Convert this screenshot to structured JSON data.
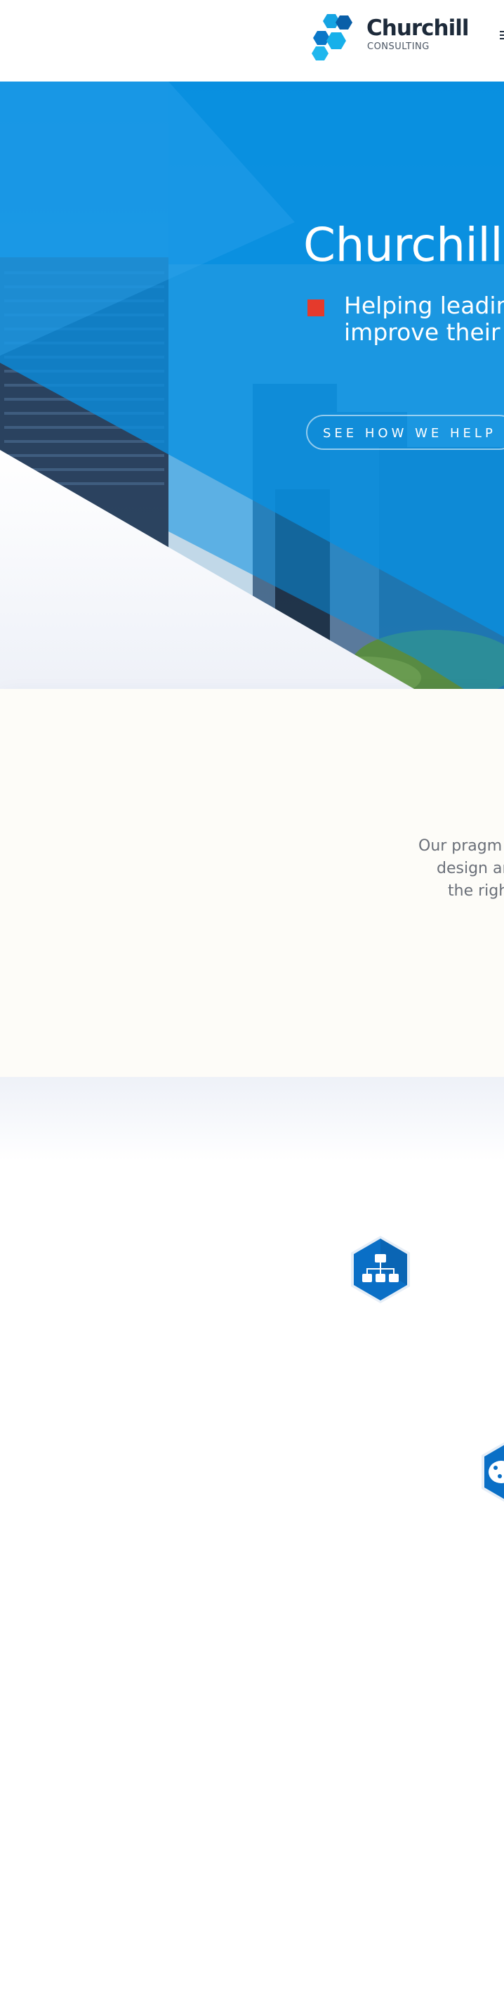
{
  "header": {
    "brand_name": "Churchill",
    "brand_sub": "CONSULTING",
    "menu_icon": "hamburger-icon"
  },
  "hero": {
    "title": "Churchill",
    "tagline_lines": [
      "Helping leadin",
      "improve their"
    ],
    "cta_label": "SEE HOW WE HELP",
    "bullet_color": "#e53a2c",
    "accent": "#0a8fe0"
  },
  "intro": {
    "lines": [
      "Our pragm",
      "design an",
      "the righ"
    ]
  },
  "services": {
    "icons": [
      "org-chart-icon",
      "palette-icon"
    ]
  },
  "colors": {
    "brand_blue": "#0a8fe0",
    "brand_dark": "#1d2a3a",
    "intro_bg": "#fdfcf8"
  }
}
